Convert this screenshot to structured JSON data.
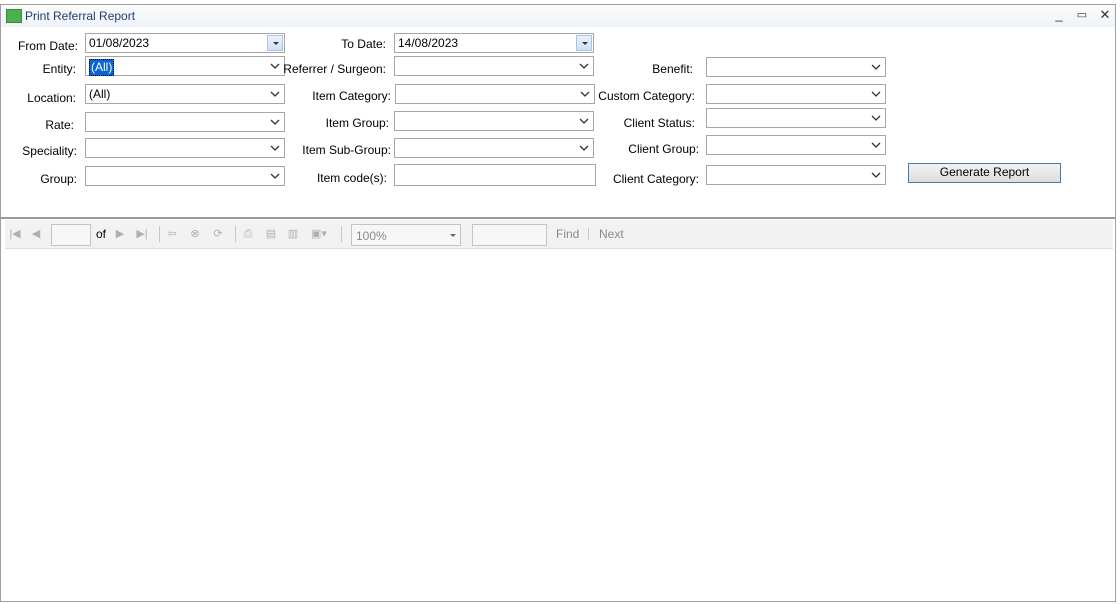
{
  "window": {
    "title": "Print Referral Report"
  },
  "form": {
    "from_date": {
      "label": "From Date:",
      "value": "01/08/2023"
    },
    "to_date": {
      "label": "To Date:",
      "value": "14/08/2023"
    },
    "entity": {
      "label": "Entity:",
      "value": "(All)"
    },
    "referrer": {
      "label": "Referrer / Surgeon:",
      "value": ""
    },
    "benefit": {
      "label": "Benefit:",
      "value": ""
    },
    "location": {
      "label": "Location:",
      "value": "(All)"
    },
    "item_category": {
      "label": "Item Category:",
      "value": ""
    },
    "custom_category": {
      "label": "Custom Category:",
      "value": ""
    },
    "rate": {
      "label": "Rate:",
      "value": ""
    },
    "item_group": {
      "label": "Item Group:",
      "value": ""
    },
    "client_status": {
      "label": "Client Status:",
      "value": ""
    },
    "speciality": {
      "label": "Speciality:",
      "value": ""
    },
    "item_sub_group": {
      "label": "Item Sub-Group:",
      "value": ""
    },
    "client_group": {
      "label": "Client Group:",
      "value": ""
    },
    "group": {
      "label": "Group:",
      "value": ""
    },
    "item_codes": {
      "label": "Item code(s):",
      "value": ""
    },
    "client_category": {
      "label": "Client Category:",
      "value": ""
    },
    "generate_label": "Generate Report"
  },
  "toolbar": {
    "page_value": "",
    "of_label": "of",
    "zoom_value": "100%",
    "find_value": "",
    "find_label": "Find",
    "next_label": "Next"
  }
}
